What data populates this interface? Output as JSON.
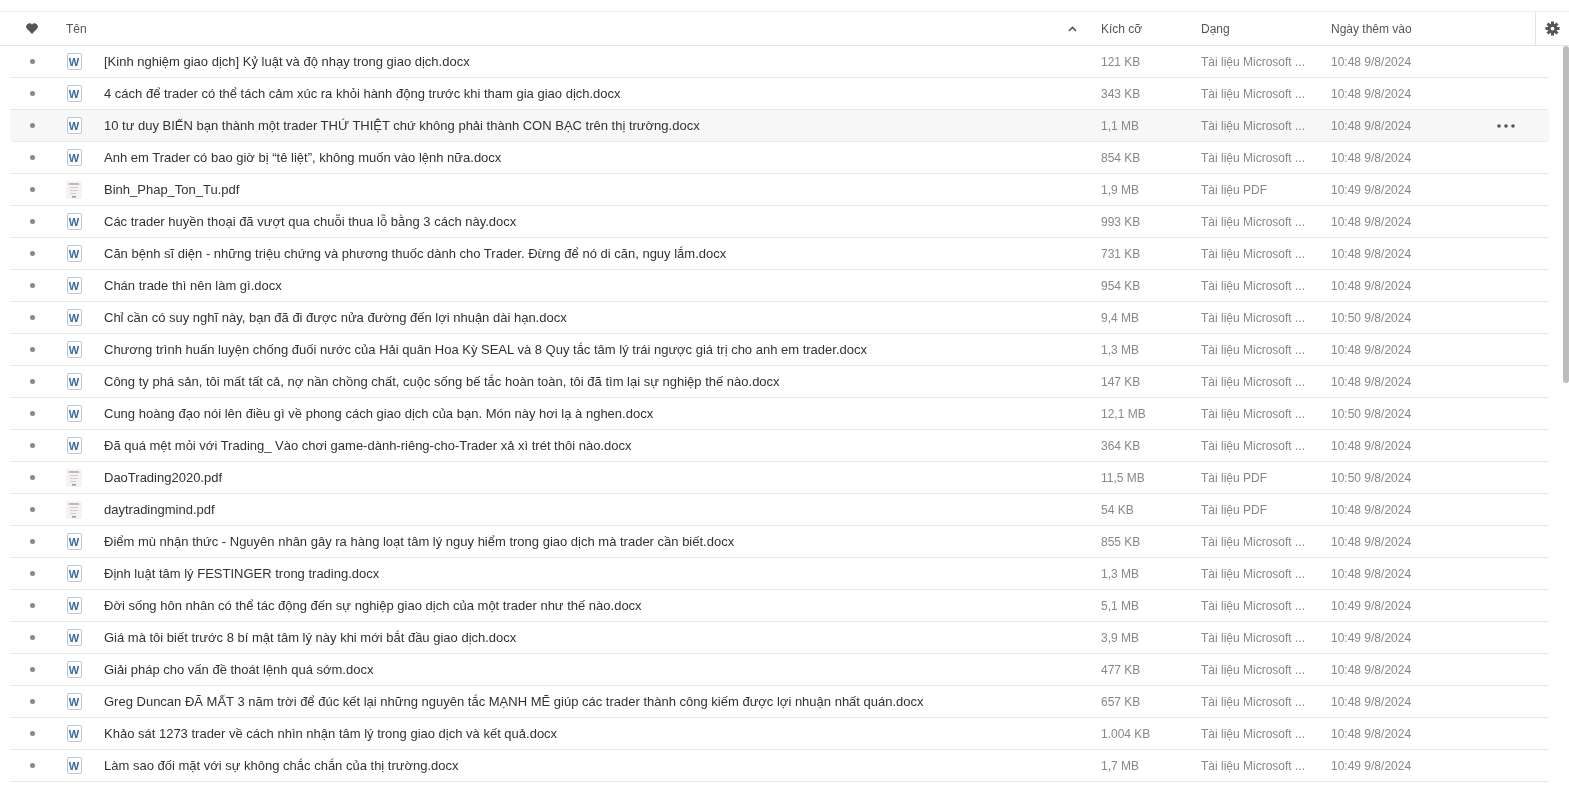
{
  "columns": {
    "name": "Tên",
    "size": "Kích cỡ",
    "type": "Dạng",
    "added": "Ngày thêm vào"
  },
  "rows": [
    {
      "icon": {
        "kind": "word",
        "label": "W"
      },
      "name": "[Kinh nghiệm giao dịch] Kỷ luật và độ nhạy trong giao dịch.docx",
      "size": "121 KB",
      "type": "Tài liệu Microsoft ...",
      "added": "10:48 9/8/2024",
      "favorite": false,
      "hovered": false
    },
    {
      "icon": {
        "kind": "word",
        "label": "W"
      },
      "name": "4 cách để trader có thể tách cảm xúc ra khỏi hành động trước khi tham gia giao dịch.docx",
      "size": "343 KB",
      "type": "Tài liệu Microsoft ...",
      "added": "10:48 9/8/2024",
      "favorite": false,
      "hovered": false
    },
    {
      "icon": {
        "kind": "word",
        "label": "W"
      },
      "name": "10 tư duy BIẾN bạn thành một trader THỨ THIỆT chứ không phải thành CON BẠC trên thị trường.docx",
      "size": "1,1 MB",
      "type": "Tài liệu Microsoft ...",
      "added": "10:48 9/8/2024",
      "favorite": false,
      "hovered": true
    },
    {
      "icon": {
        "kind": "word",
        "label": "W"
      },
      "name": "Anh em Trader có bao giờ bị “tê liệt”, không muốn vào lệnh nữa.docx",
      "size": "854 KB",
      "type": "Tài liệu Microsoft ...",
      "added": "10:48 9/8/2024",
      "favorite": false,
      "hovered": false
    },
    {
      "icon": {
        "kind": "thumbnail"
      },
      "name": "Binh_Phap_Ton_Tu.pdf",
      "size": "1,9 MB",
      "type": "Tài liệu PDF",
      "added": "10:49 9/8/2024",
      "favorite": false,
      "hovered": false
    },
    {
      "icon": {
        "kind": "word",
        "label": "W"
      },
      "name": "Các trader huyền thoại đã vượt qua chuỗi thua lỗ bằng 3 cách này.docx",
      "size": "993 KB",
      "type": "Tài liệu Microsoft ...",
      "added": "10:48 9/8/2024",
      "favorite": false,
      "hovered": false
    },
    {
      "icon": {
        "kind": "word",
        "label": "W"
      },
      "name": "Căn bệnh sĩ diện - những triệu chứng và phương thuốc dành cho Trader. Đừng để nó di căn, nguy lắm.docx",
      "size": "731 KB",
      "type": "Tài liệu Microsoft ...",
      "added": "10:48 9/8/2024",
      "favorite": false,
      "hovered": false
    },
    {
      "icon": {
        "kind": "word",
        "label": "W"
      },
      "name": "Chán trade thì nên làm gì.docx",
      "size": "954 KB",
      "type": "Tài liệu Microsoft ...",
      "added": "10:48 9/8/2024",
      "favorite": false,
      "hovered": false
    },
    {
      "icon": {
        "kind": "word",
        "label": "W"
      },
      "name": "Chỉ cần có suy nghĩ này, bạn đã đi được nửa đường đến lợi nhuận dài hạn.docx",
      "size": "9,4 MB",
      "type": "Tài liệu Microsoft ...",
      "added": "10:50 9/8/2024",
      "favorite": false,
      "hovered": false
    },
    {
      "icon": {
        "kind": "word",
        "label": "W"
      },
      "name": "Chương trình huấn luyện chống đuối nước của Hải quân Hoa Kỳ SEAL và 8 Quy tắc tâm lý trái ngược giá trị cho anh em trader.docx",
      "size": "1,3 MB",
      "type": "Tài liệu Microsoft ...",
      "added": "10:48 9/8/2024",
      "favorite": false,
      "hovered": false
    },
    {
      "icon": {
        "kind": "word",
        "label": "W"
      },
      "name": "Công ty phá sản, tôi mất tất cả, nợ nần chồng chất, cuộc sống bế tắc hoàn toàn, tôi đã tìm lại sự nghiệp thế nào.docx",
      "size": "147 KB",
      "type": "Tài liệu Microsoft ...",
      "added": "10:48 9/8/2024",
      "favorite": false,
      "hovered": false
    },
    {
      "icon": {
        "kind": "word",
        "label": "W"
      },
      "name": "Cung hoàng đạo nói lên điều gì về phong cách giao dịch của bạn. Món này hơi lạ à nghen.docx",
      "size": "12,1 MB",
      "type": "Tài liệu Microsoft ...",
      "added": "10:50 9/8/2024",
      "favorite": false,
      "hovered": false
    },
    {
      "icon": {
        "kind": "word",
        "label": "W"
      },
      "name": "Đã quá mệt mỏi với Trading_ Vào chơi game-dành-riêng-cho-Trader xả xì trét thôi nào.docx",
      "size": "364 KB",
      "type": "Tài liệu Microsoft ...",
      "added": "10:48 9/8/2024",
      "favorite": false,
      "hovered": false
    },
    {
      "icon": {
        "kind": "thumbnail"
      },
      "name": "DaoTrading2020.pdf",
      "size": "11,5 MB",
      "type": "Tài liệu PDF",
      "added": "10:50 9/8/2024",
      "favorite": false,
      "hovered": false
    },
    {
      "icon": {
        "kind": "thumbnail"
      },
      "name": "daytradingmind.pdf",
      "size": "54 KB",
      "type": "Tài liệu PDF",
      "added": "10:48 9/8/2024",
      "favorite": false,
      "hovered": false
    },
    {
      "icon": {
        "kind": "word",
        "label": "W"
      },
      "name": "Điểm mù nhận thức - Nguyên nhân gây ra hàng loạt tâm lý nguy hiểm trong giao dịch mà trader cần biết.docx",
      "size": "855 KB",
      "type": "Tài liệu Microsoft ...",
      "added": "10:48 9/8/2024",
      "favorite": false,
      "hovered": false
    },
    {
      "icon": {
        "kind": "word",
        "label": "W"
      },
      "name": "Định luật tâm lý FESTINGER trong trading.docx",
      "size": "1,3 MB",
      "type": "Tài liệu Microsoft ...",
      "added": "10:48 9/8/2024",
      "favorite": false,
      "hovered": false
    },
    {
      "icon": {
        "kind": "word",
        "label": "W"
      },
      "name": "Đời sống hôn nhân có thể tác động đến sự nghiệp giao dịch của một trader như thế nào.docx",
      "size": "5,1 MB",
      "type": "Tài liệu Microsoft ...",
      "added": "10:49 9/8/2024",
      "favorite": false,
      "hovered": false
    },
    {
      "icon": {
        "kind": "word",
        "label": "W"
      },
      "name": "Giá mà tôi biết trước 8 bí mật tâm lý này khi mới bắt đầu giao dịch.docx",
      "size": "3,9 MB",
      "type": "Tài liệu Microsoft ...",
      "added": "10:49 9/8/2024",
      "favorite": false,
      "hovered": false
    },
    {
      "icon": {
        "kind": "word",
        "label": "W"
      },
      "name": "Giải pháp cho vấn đề thoát lệnh quá sớm.docx",
      "size": "477 KB",
      "type": "Tài liệu Microsoft ...",
      "added": "10:48 9/8/2024",
      "favorite": false,
      "hovered": false
    },
    {
      "icon": {
        "kind": "word",
        "label": "W"
      },
      "name": "Greg Duncan ĐÃ MẤT 3 năm trời để đúc kết lại những nguyên tắc MẠNH MẼ giúp các trader thành công kiếm được lợi nhuận nhất quán.docx",
      "size": "657 KB",
      "type": "Tài liệu Microsoft ...",
      "added": "10:48 9/8/2024",
      "favorite": false,
      "hovered": false
    },
    {
      "icon": {
        "kind": "word",
        "label": "W"
      },
      "name": "Khảo sát 1273 trader về cách nhìn nhận tâm lý trong giao dịch và kết quả.docx",
      "size": "1.004 KB",
      "type": "Tài liệu Microsoft ...",
      "added": "10:48 9/8/2024",
      "favorite": false,
      "hovered": false
    },
    {
      "icon": {
        "kind": "word",
        "label": "W"
      },
      "name": "Làm sao đối mặt với sự không chắc chắn của thị trường.docx",
      "size": "1,7 MB",
      "type": "Tài liệu Microsoft ...",
      "added": "10:49 9/8/2024",
      "favorite": false,
      "hovered": false
    }
  ]
}
